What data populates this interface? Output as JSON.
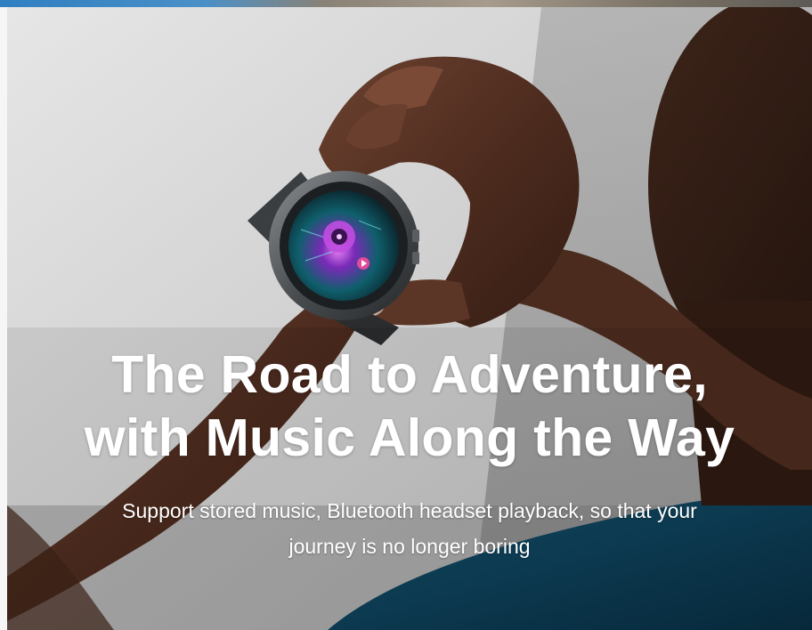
{
  "banner": {
    "headline_line1": "The Road to Adventure,",
    "headline_line2": "with Music Along the Way",
    "subline_line1": "Support stored music, Bluetooth headset playback, so that your",
    "subline_line2": "journey is no longer boring"
  },
  "colors": {
    "text": "#ffffff",
    "background_wall": "#d9d9d9",
    "skin": "#5a3424",
    "shirt": "#0f3f58",
    "watch_screen_accent": "#b048d8"
  },
  "icons": {
    "watch": "smartwatch-icon",
    "music_disc": "music-disc-icon",
    "play": "play-icon"
  }
}
